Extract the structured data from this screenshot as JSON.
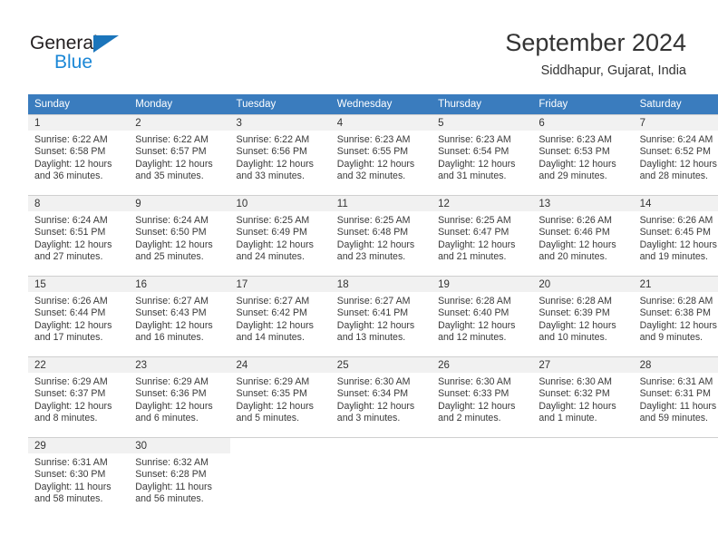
{
  "brand": {
    "name_top": "General",
    "name_bottom": "Blue",
    "accent_color": "#1b87d6",
    "triangle_color": "#1b75bb"
  },
  "header": {
    "title": "September 2024",
    "subtitle": "Siddhapur, Gujarat, India",
    "header_bg_color": "#3a7cbe",
    "daynum_band_color": "#f1f1f1"
  },
  "weekdays": [
    "Sunday",
    "Monday",
    "Tuesday",
    "Wednesday",
    "Thursday",
    "Friday",
    "Saturday"
  ],
  "weeks": [
    [
      {
        "day": "1",
        "sunrise": "Sunrise: 6:22 AM",
        "sunset": "Sunset: 6:58 PM",
        "daylight_line1": "Daylight: 12 hours",
        "daylight_line2": "and 36 minutes."
      },
      {
        "day": "2",
        "sunrise": "Sunrise: 6:22 AM",
        "sunset": "Sunset: 6:57 PM",
        "daylight_line1": "Daylight: 12 hours",
        "daylight_line2": "and 35 minutes."
      },
      {
        "day": "3",
        "sunrise": "Sunrise: 6:22 AM",
        "sunset": "Sunset: 6:56 PM",
        "daylight_line1": "Daylight: 12 hours",
        "daylight_line2": "and 33 minutes."
      },
      {
        "day": "4",
        "sunrise": "Sunrise: 6:23 AM",
        "sunset": "Sunset: 6:55 PM",
        "daylight_line1": "Daylight: 12 hours",
        "daylight_line2": "and 32 minutes."
      },
      {
        "day": "5",
        "sunrise": "Sunrise: 6:23 AM",
        "sunset": "Sunset: 6:54 PM",
        "daylight_line1": "Daylight: 12 hours",
        "daylight_line2": "and 31 minutes."
      },
      {
        "day": "6",
        "sunrise": "Sunrise: 6:23 AM",
        "sunset": "Sunset: 6:53 PM",
        "daylight_line1": "Daylight: 12 hours",
        "daylight_line2": "and 29 minutes."
      },
      {
        "day": "7",
        "sunrise": "Sunrise: 6:24 AM",
        "sunset": "Sunset: 6:52 PM",
        "daylight_line1": "Daylight: 12 hours",
        "daylight_line2": "and 28 minutes."
      }
    ],
    [
      {
        "day": "8",
        "sunrise": "Sunrise: 6:24 AM",
        "sunset": "Sunset: 6:51 PM",
        "daylight_line1": "Daylight: 12 hours",
        "daylight_line2": "and 27 minutes."
      },
      {
        "day": "9",
        "sunrise": "Sunrise: 6:24 AM",
        "sunset": "Sunset: 6:50 PM",
        "daylight_line1": "Daylight: 12 hours",
        "daylight_line2": "and 25 minutes."
      },
      {
        "day": "10",
        "sunrise": "Sunrise: 6:25 AM",
        "sunset": "Sunset: 6:49 PM",
        "daylight_line1": "Daylight: 12 hours",
        "daylight_line2": "and 24 minutes."
      },
      {
        "day": "11",
        "sunrise": "Sunrise: 6:25 AM",
        "sunset": "Sunset: 6:48 PM",
        "daylight_line1": "Daylight: 12 hours",
        "daylight_line2": "and 23 minutes."
      },
      {
        "day": "12",
        "sunrise": "Sunrise: 6:25 AM",
        "sunset": "Sunset: 6:47 PM",
        "daylight_line1": "Daylight: 12 hours",
        "daylight_line2": "and 21 minutes."
      },
      {
        "day": "13",
        "sunrise": "Sunrise: 6:26 AM",
        "sunset": "Sunset: 6:46 PM",
        "daylight_line1": "Daylight: 12 hours",
        "daylight_line2": "and 20 minutes."
      },
      {
        "day": "14",
        "sunrise": "Sunrise: 6:26 AM",
        "sunset": "Sunset: 6:45 PM",
        "daylight_line1": "Daylight: 12 hours",
        "daylight_line2": "and 19 minutes."
      }
    ],
    [
      {
        "day": "15",
        "sunrise": "Sunrise: 6:26 AM",
        "sunset": "Sunset: 6:44 PM",
        "daylight_line1": "Daylight: 12 hours",
        "daylight_line2": "and 17 minutes."
      },
      {
        "day": "16",
        "sunrise": "Sunrise: 6:27 AM",
        "sunset": "Sunset: 6:43 PM",
        "daylight_line1": "Daylight: 12 hours",
        "daylight_line2": "and 16 minutes."
      },
      {
        "day": "17",
        "sunrise": "Sunrise: 6:27 AM",
        "sunset": "Sunset: 6:42 PM",
        "daylight_line1": "Daylight: 12 hours",
        "daylight_line2": "and 14 minutes."
      },
      {
        "day": "18",
        "sunrise": "Sunrise: 6:27 AM",
        "sunset": "Sunset: 6:41 PM",
        "daylight_line1": "Daylight: 12 hours",
        "daylight_line2": "and 13 minutes."
      },
      {
        "day": "19",
        "sunrise": "Sunrise: 6:28 AM",
        "sunset": "Sunset: 6:40 PM",
        "daylight_line1": "Daylight: 12 hours",
        "daylight_line2": "and 12 minutes."
      },
      {
        "day": "20",
        "sunrise": "Sunrise: 6:28 AM",
        "sunset": "Sunset: 6:39 PM",
        "daylight_line1": "Daylight: 12 hours",
        "daylight_line2": "and 10 minutes."
      },
      {
        "day": "21",
        "sunrise": "Sunrise: 6:28 AM",
        "sunset": "Sunset: 6:38 PM",
        "daylight_line1": "Daylight: 12 hours",
        "daylight_line2": "and 9 minutes."
      }
    ],
    [
      {
        "day": "22",
        "sunrise": "Sunrise: 6:29 AM",
        "sunset": "Sunset: 6:37 PM",
        "daylight_line1": "Daylight: 12 hours",
        "daylight_line2": "and 8 minutes."
      },
      {
        "day": "23",
        "sunrise": "Sunrise: 6:29 AM",
        "sunset": "Sunset: 6:36 PM",
        "daylight_line1": "Daylight: 12 hours",
        "daylight_line2": "and 6 minutes."
      },
      {
        "day": "24",
        "sunrise": "Sunrise: 6:29 AM",
        "sunset": "Sunset: 6:35 PM",
        "daylight_line1": "Daylight: 12 hours",
        "daylight_line2": "and 5 minutes."
      },
      {
        "day": "25",
        "sunrise": "Sunrise: 6:30 AM",
        "sunset": "Sunset: 6:34 PM",
        "daylight_line1": "Daylight: 12 hours",
        "daylight_line2": "and 3 minutes."
      },
      {
        "day": "26",
        "sunrise": "Sunrise: 6:30 AM",
        "sunset": "Sunset: 6:33 PM",
        "daylight_line1": "Daylight: 12 hours",
        "daylight_line2": "and 2 minutes."
      },
      {
        "day": "27",
        "sunrise": "Sunrise: 6:30 AM",
        "sunset": "Sunset: 6:32 PM",
        "daylight_line1": "Daylight: 12 hours",
        "daylight_line2": "and 1 minute."
      },
      {
        "day": "28",
        "sunrise": "Sunrise: 6:31 AM",
        "sunset": "Sunset: 6:31 PM",
        "daylight_line1": "Daylight: 11 hours",
        "daylight_line2": "and 59 minutes."
      }
    ],
    [
      {
        "day": "29",
        "sunrise": "Sunrise: 6:31 AM",
        "sunset": "Sunset: 6:30 PM",
        "daylight_line1": "Daylight: 11 hours",
        "daylight_line2": "and 58 minutes."
      },
      {
        "day": "30",
        "sunrise": "Sunrise: 6:32 AM",
        "sunset": "Sunset: 6:28 PM",
        "daylight_line1": "Daylight: 11 hours",
        "daylight_line2": "and 56 minutes."
      },
      {
        "day": "",
        "sunrise": "",
        "sunset": "",
        "daylight_line1": "",
        "daylight_line2": ""
      },
      {
        "day": "",
        "sunrise": "",
        "sunset": "",
        "daylight_line1": "",
        "daylight_line2": ""
      },
      {
        "day": "",
        "sunrise": "",
        "sunset": "",
        "daylight_line1": "",
        "daylight_line2": ""
      },
      {
        "day": "",
        "sunrise": "",
        "sunset": "",
        "daylight_line1": "",
        "daylight_line2": ""
      },
      {
        "day": "",
        "sunrise": "",
        "sunset": "",
        "daylight_line1": "",
        "daylight_line2": ""
      }
    ]
  ]
}
